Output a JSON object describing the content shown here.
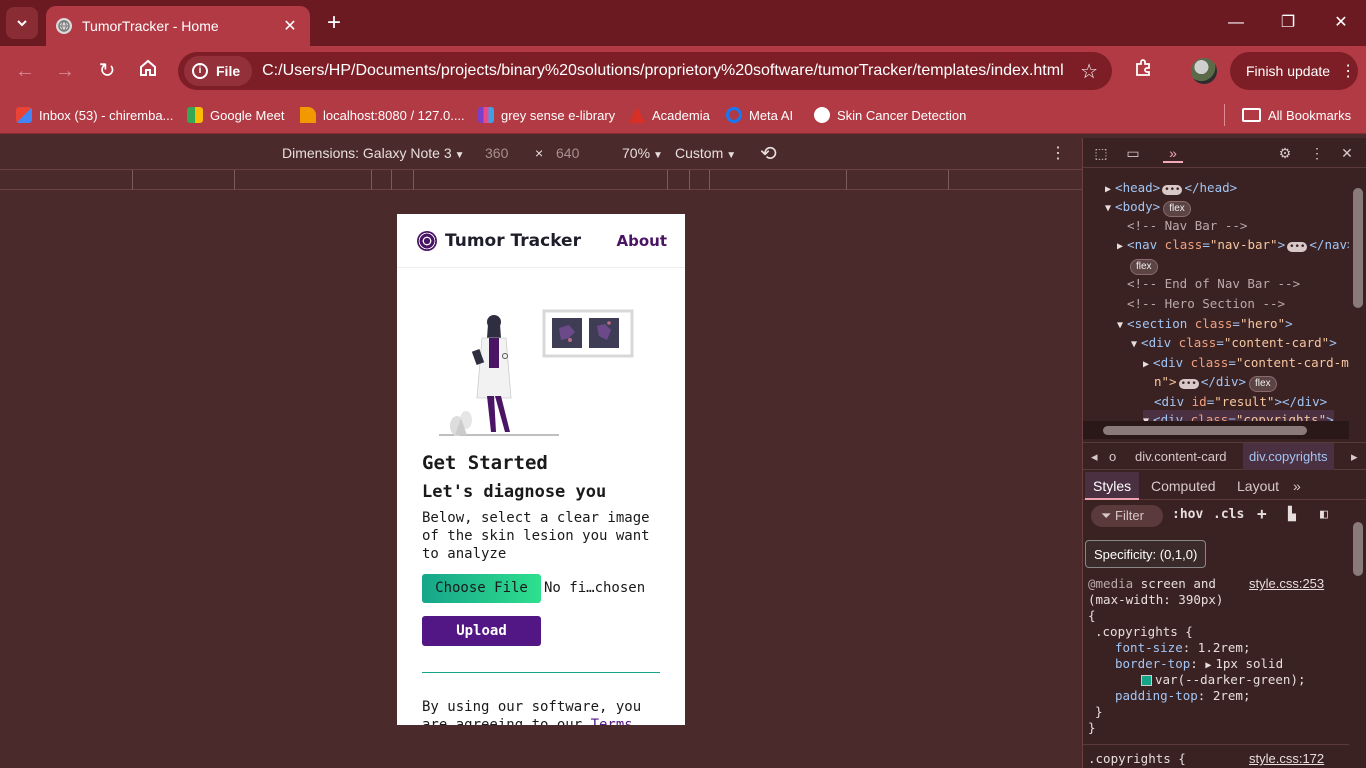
{
  "browser": {
    "tab_title": "TumorTracker - Home",
    "url_scheme_label": "File",
    "url": "C:/Users/HP/Documents/projects/binary%20solutions/proprietory%20software/tumorTracker/templates/index.html",
    "finish_update_label": "Finish update",
    "bookmarks": [
      {
        "label": "Inbox (53) - chiremba...",
        "icon_color": "#ea4335"
      },
      {
        "label": "Google Meet",
        "icon_color": "#34a853"
      },
      {
        "label": "localhost:8080 / 127.0....",
        "icon_color": "#f29900"
      },
      {
        "label": "grey sense e-library",
        "icon_color": "#7b3fc9"
      },
      {
        "label": "Academia",
        "icon_color": "#d93025"
      },
      {
        "label": "Meta AI",
        "icon_color": "#1877f2"
      },
      {
        "label": "Skin Cancer Detection",
        "icon_color": "#ffffff"
      }
    ],
    "all_bookmarks_label": "All Bookmarks"
  },
  "device_toolbar": {
    "dimensions_label": "Dimensions: Galaxy Note 3",
    "width": "360",
    "times": "×",
    "height": "640",
    "zoom": "70%",
    "throttle": "Custom"
  },
  "app": {
    "brand_name": "Tumor Tracker",
    "about_link": "About",
    "heading_get_started": "Get Started",
    "heading_diagnose": "Let's diagnose you",
    "description": "Below, select a clear image of the skin lesion you want to analyze",
    "choose_file_label": "Choose File",
    "no_file_label": "No fi…chosen",
    "upload_label": "Upload",
    "terms_prefix": "By using our software, you are agreeing to our ",
    "terms_link": "Terms"
  },
  "devtools": {
    "dom": {
      "head": "head",
      "body": "body",
      "flex": "flex",
      "c_nav_bar": "<!-- Nav Bar -->",
      "nav_tag": "nav",
      "nav_class_attr": "class",
      "nav_class_val": "\"nav-bar\"",
      "c_end_nav": "<!-- End of Nav Bar -->",
      "c_hero": "<!-- Hero Section -->",
      "section_tag": "section",
      "section_class_val": "\"hero\"",
      "div_tag": "div",
      "content_card_val": "\"content-card\"",
      "content_card_m_val": "\"content-card-m",
      "content_card_m_tail": "n\">",
      "id_attr": "id",
      "result_val": "\"result\"",
      "copyrights_val": "\"copyrights\""
    },
    "crumbs": [
      "o",
      "div.content-card",
      "div.copyrights"
    ],
    "style_tabs": [
      "Styles",
      "Computed",
      "Layout"
    ],
    "filter_label": "Filter",
    "hov": ":hov",
    "cls": ".cls",
    "tooltip": "Specificity: (0,1,0)",
    "rule1": {
      "media_kw": "@media",
      "media_q1": " screen and",
      "media_q2": "(max-width: 390px)",
      "source": "style.css:253",
      "selector": ".copyrights {",
      "props": [
        {
          "name": "font-size",
          "value": "1.2rem;"
        },
        {
          "name": "border-top",
          "value": "1px solid"
        },
        {
          "name": "",
          "value": "var(--darker-green);"
        },
        {
          "name": "padding-top",
          "value": "2rem;"
        }
      ]
    },
    "rule2": {
      "selector": ".copyrights {",
      "source": "style.css:172"
    }
  }
}
